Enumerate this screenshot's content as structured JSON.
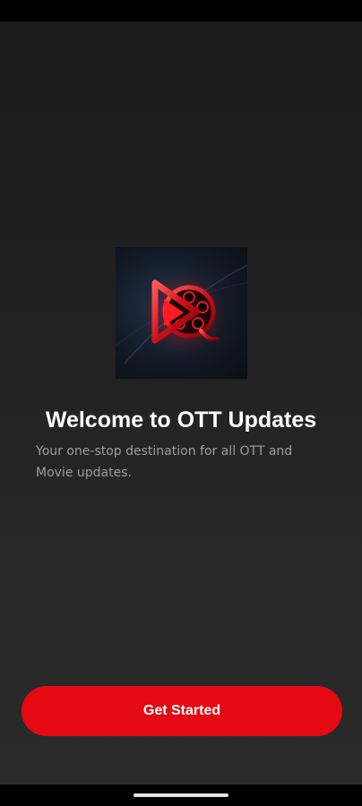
{
  "app": {
    "logo_icon": "film-reel-play-icon",
    "accent_color": "#e50914"
  },
  "welcome": {
    "title": "Welcome to OTT Updates",
    "subtitle": "Your one-stop destination for all OTT and Movie updates."
  },
  "actions": {
    "get_started_label": "Get Started"
  }
}
